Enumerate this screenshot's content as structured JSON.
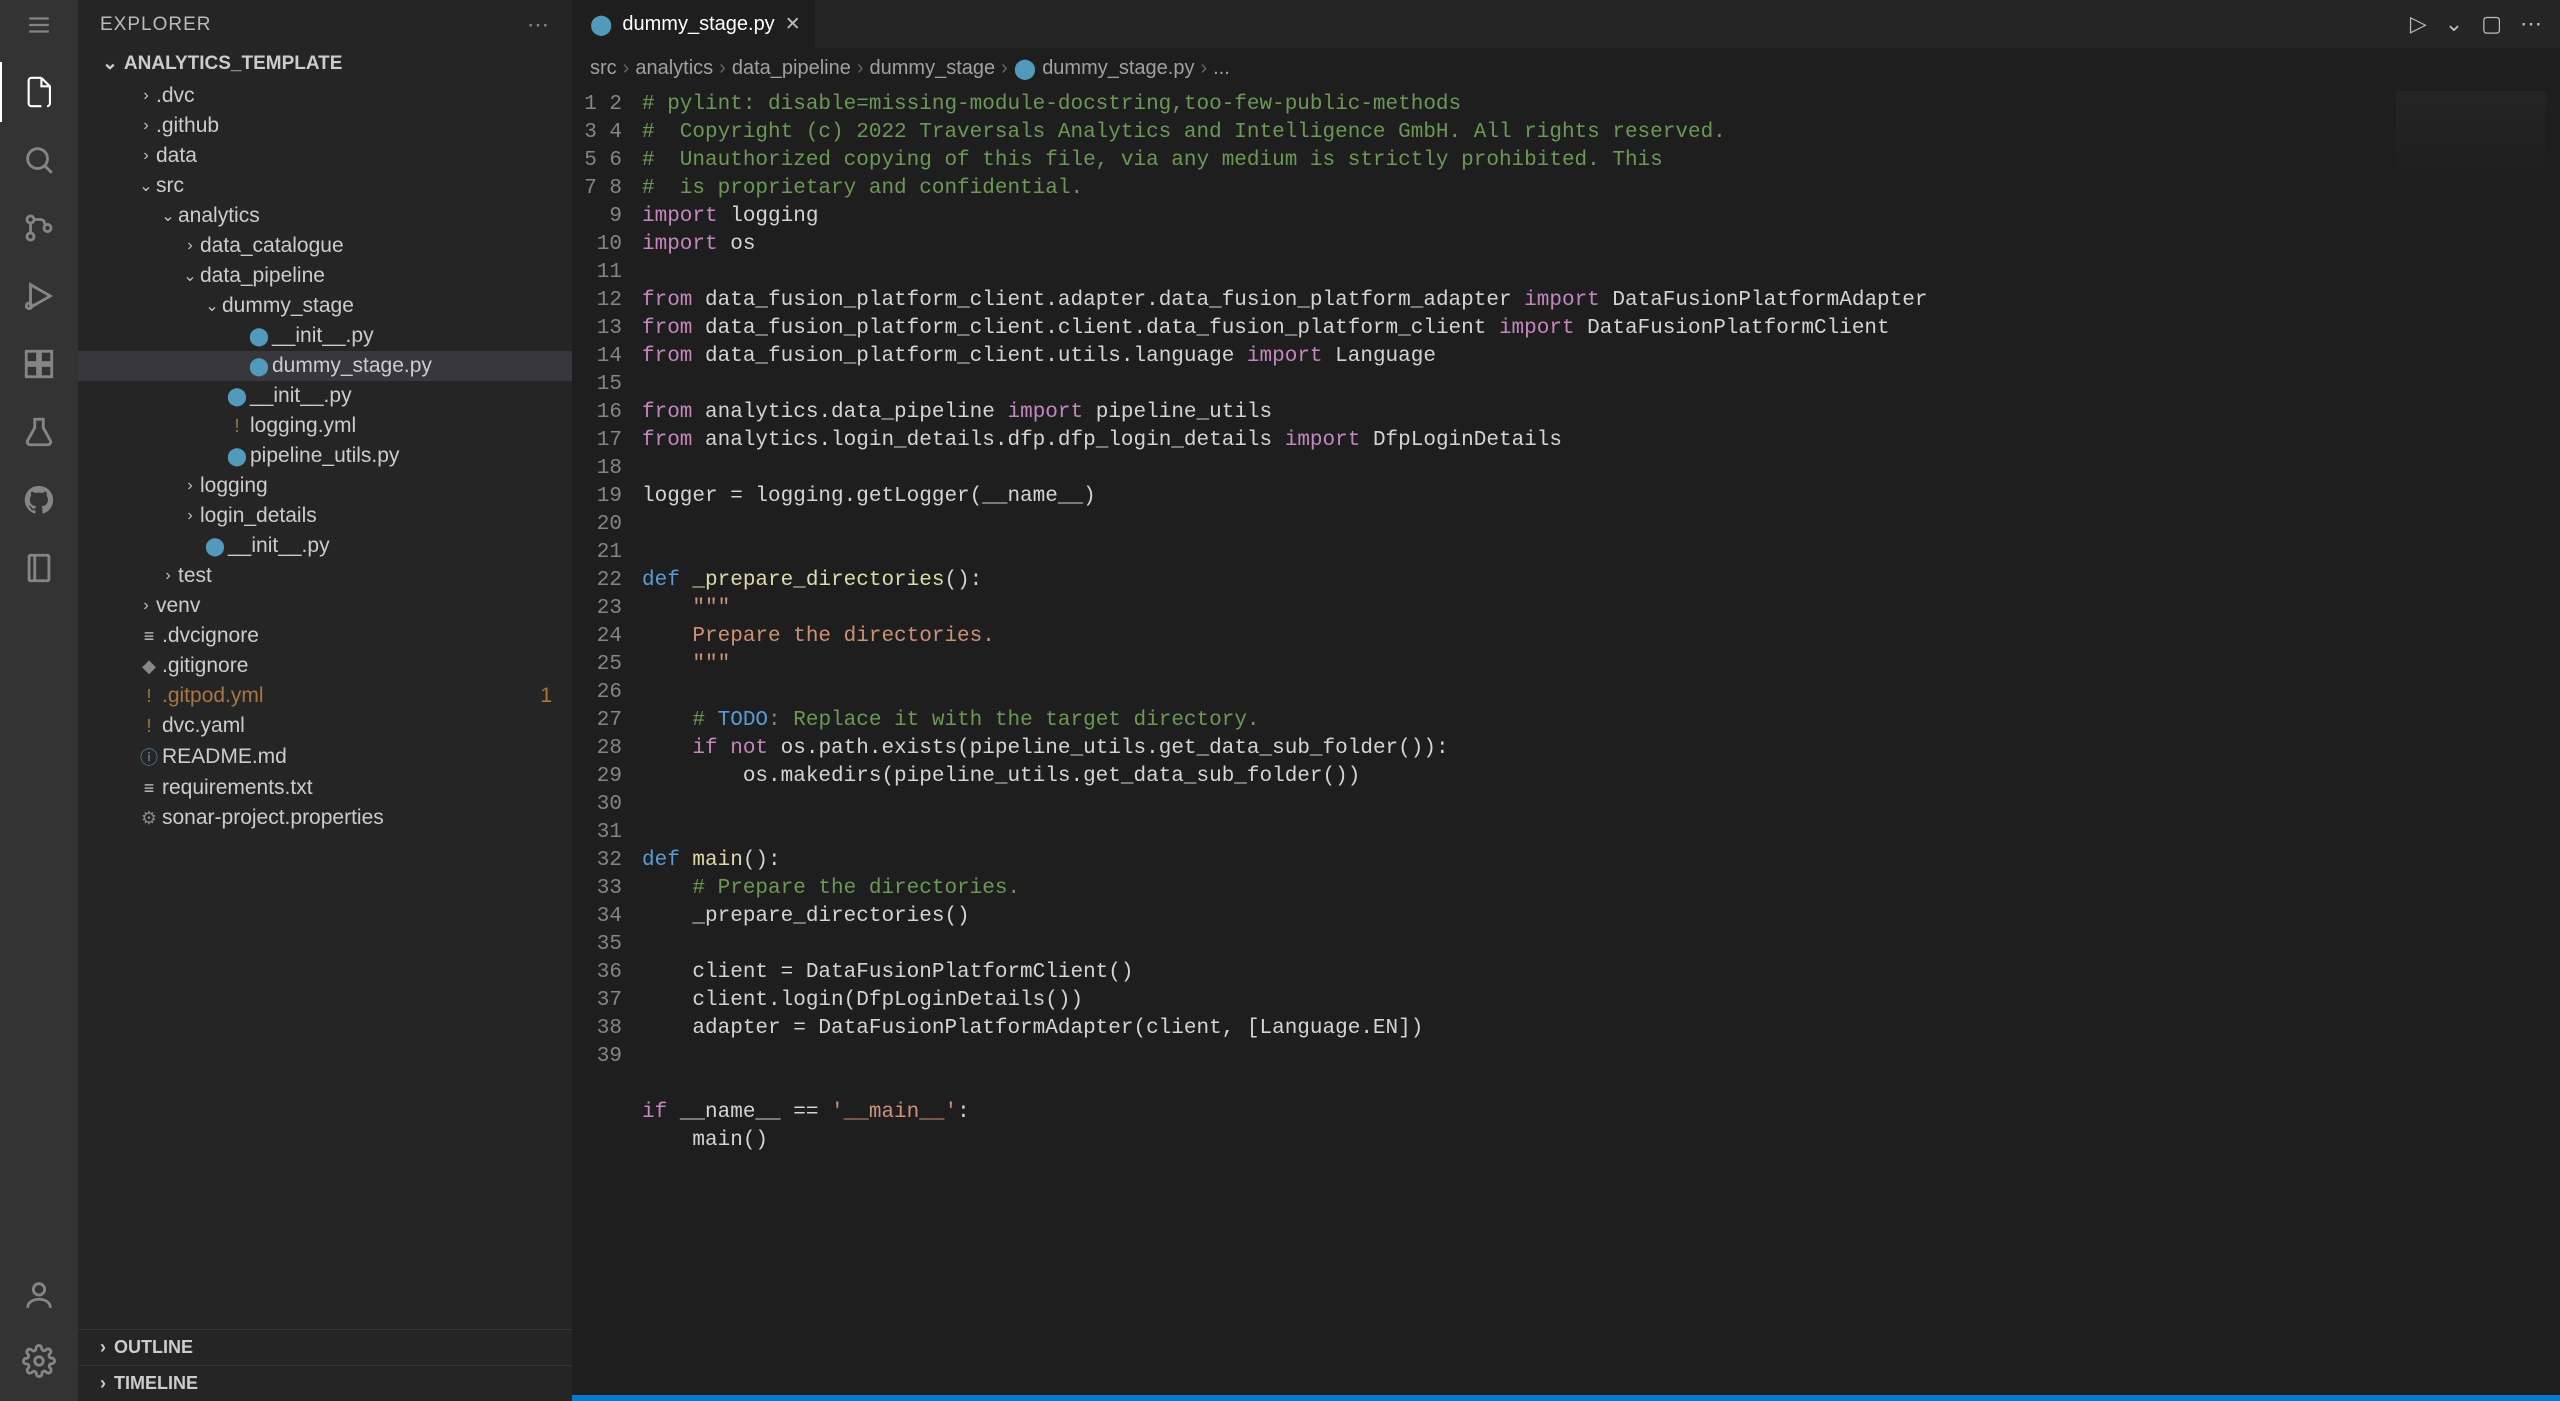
{
  "sidebar": {
    "title": "EXPLORER",
    "root": "ANALYTICS_TEMPLATE",
    "tree": {
      "dvc": ".dvc",
      "github": ".github",
      "data": "data",
      "src": "src",
      "analytics": "analytics",
      "data_catalogue": "data_catalogue",
      "data_pipeline": "data_pipeline",
      "dummy_stage": "dummy_stage",
      "init1": "__init__.py",
      "dummy_stage_py": "dummy_stage.py",
      "init2": "__init__.py",
      "logging_yml": "logging.yml",
      "pipeline_utils": "pipeline_utils.py",
      "logging": "logging",
      "login_details": "login_details",
      "init3": "__init__.py",
      "test": "test",
      "venv": "venv",
      "dvcignore": ".dvcignore",
      "gitignore": ".gitignore",
      "gitpod_yml": ".gitpod.yml",
      "gitpod_badge": "1",
      "dvc_yaml": "dvc.yaml",
      "readme": "README.md",
      "requirements": "requirements.txt",
      "sonar": "sonar-project.properties"
    },
    "outline": "OUTLINE",
    "timeline": "TIMELINE"
  },
  "tab": {
    "label": "dummy_stage.py"
  },
  "breadcrumb": {
    "seg1": "src",
    "seg2": "analytics",
    "seg3": "data_pipeline",
    "seg4": "dummy_stage",
    "seg5": "dummy_stage.py",
    "seg6": "..."
  },
  "code": {
    "line_count": 39,
    "l1": "# pylint: disable=missing-module-docstring,too-few-public-methods",
    "l2": "#  Copyright (c) 2022 Traversals Analytics and Intelligence GmbH. All rights reserved.",
    "l3": "#  Unauthorized copying of this file, via any medium is strictly prohibited. This",
    "l4": "#  is proprietary and confidential.",
    "l5a": "import",
    "l5b": " logging",
    "l6a": "import",
    "l6b": " os",
    "l8a": "from",
    "l8b": " data_fusion_platform_client.adapter.data_fusion_platform_adapter ",
    "l8c": "import",
    "l8d": " DataFusionPlatformAdapter",
    "l9a": "from",
    "l9b": " data_fusion_platform_client.client.data_fusion_platform_client ",
    "l9c": "import",
    "l9d": " DataFusionPlatformClient",
    "l10a": "from",
    "l10b": " data_fusion_platform_client.utils.language ",
    "l10c": "import",
    "l10d": " Language",
    "l12a": "from",
    "l12b": " analytics.data_pipeline ",
    "l12c": "import",
    "l12d": " pipeline_utils",
    "l13a": "from",
    "l13b": " analytics.login_details.dfp.dfp_login_details ",
    "l13c": "import",
    "l13d": " DfpLoginDetails",
    "l15": "logger = logging.getLogger(__name__)",
    "l18a": "def",
    "l18b": " _prepare_directories",
    "l18c": "():",
    "l19": "    \"\"\"",
    "l20": "    Prepare the directories.",
    "l21": "    \"\"\"",
    "l23a": "    # ",
    "l23b": "TODO",
    "l23c": ": Replace it with the target directory.",
    "l24a": "    if",
    "l24b": " not",
    "l24c": " os.path.exists(pipeline_utils.get_data_sub_folder()):",
    "l25": "        os.makedirs(pipeline_utils.get_data_sub_folder())",
    "l28a": "def",
    "l28b": " main",
    "l28c": "():",
    "l29": "    # Prepare the directories.",
    "l30": "    _prepare_directories()",
    "l32": "    client = DataFusionPlatformClient()",
    "l33": "    client.login(DfpLoginDetails())",
    "l34": "    adapter = DataFusionPlatformAdapter(client, [Language.EN])",
    "l37a": "if",
    "l37b": " __name__ == ",
    "l37c": "'__main__'",
    "l37d": ":",
    "l38": "    main()"
  }
}
